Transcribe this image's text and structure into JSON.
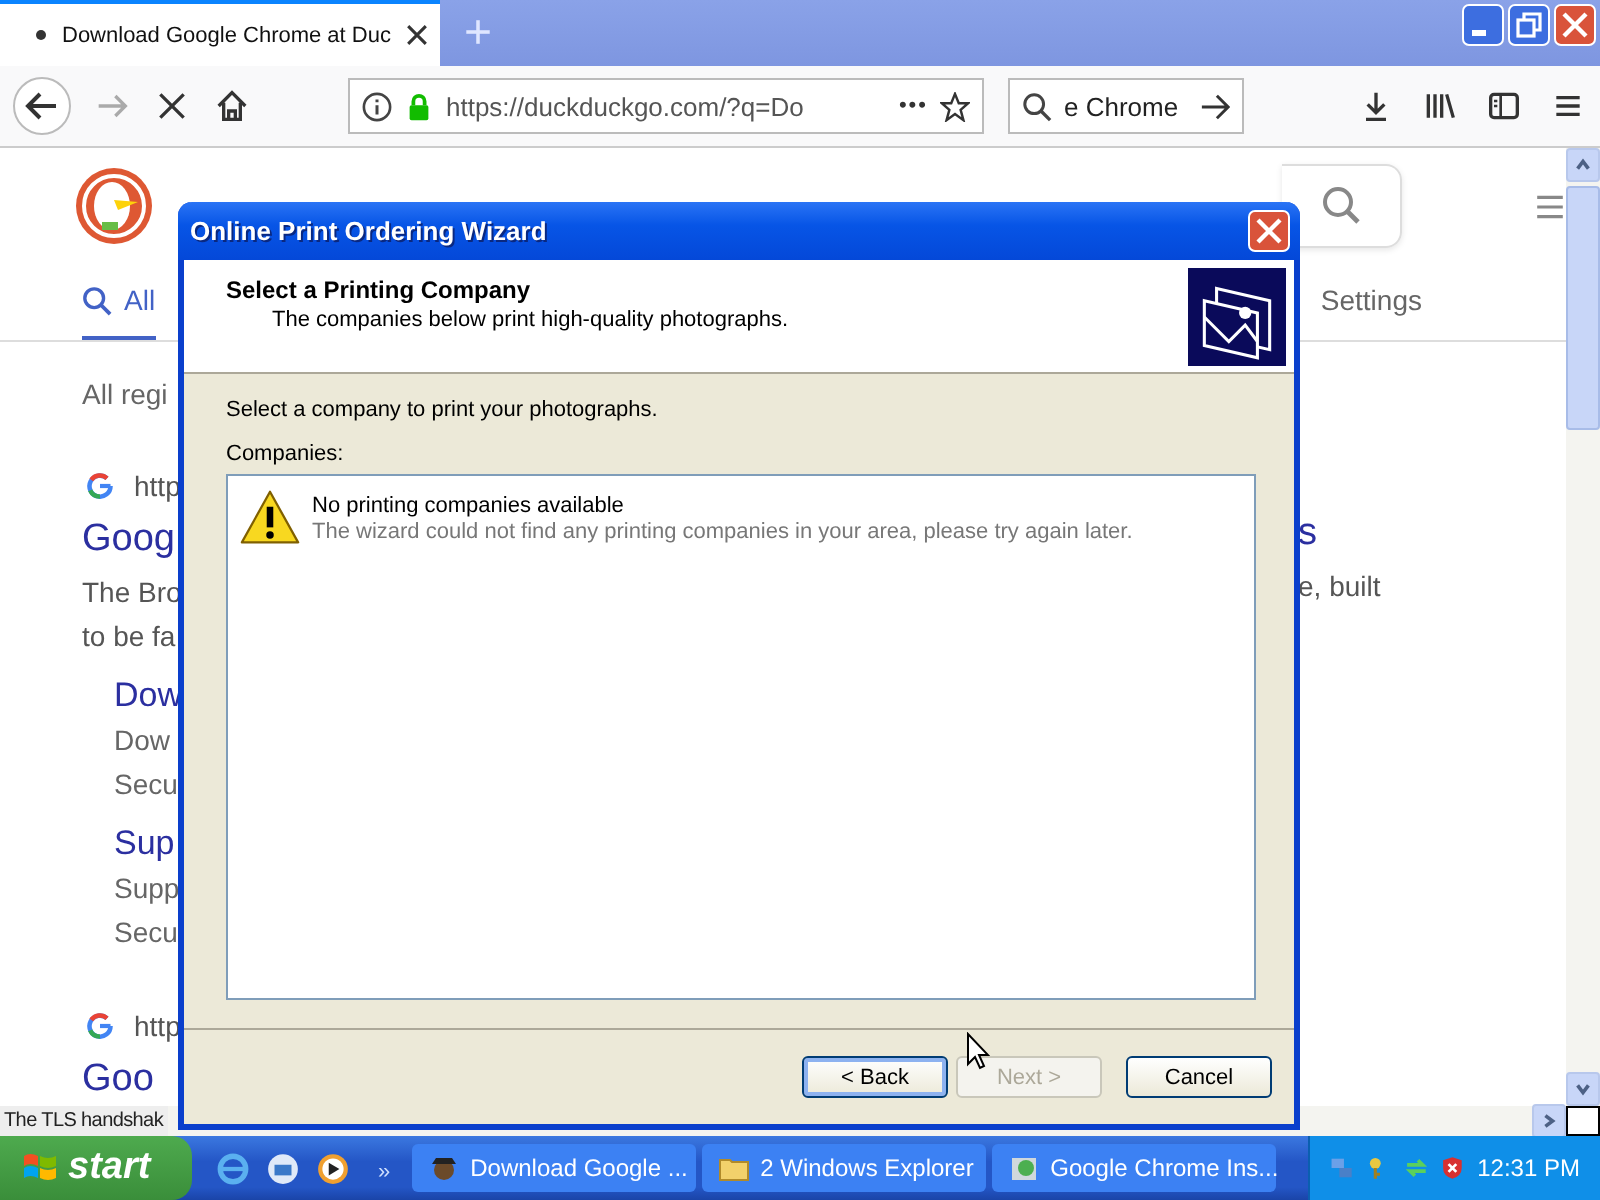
{
  "browser": {
    "tab": {
      "title": "Download Google Chrome at Duc",
      "loading": true
    },
    "new_tab": "+",
    "url": {
      "text": "https://duckduckgo.com/?q=Do",
      "secure": true
    },
    "more": "•••",
    "search_text": "e Chrome",
    "status": "The TLS handshak"
  },
  "page": {
    "tabs": [
      {
        "label": "All",
        "selected": true
      },
      {
        "label": "Settings",
        "selected": false
      }
    ],
    "left": [
      {
        "kind": "meta",
        "text": "All regi"
      },
      {
        "kind": "url",
        "text": "http"
      },
      {
        "kind": "title",
        "text": "Goog"
      },
      {
        "kind": "snippet",
        "text": "The Bro"
      },
      {
        "kind": "snippet",
        "text": "to be fa"
      },
      {
        "kind": "sublink",
        "text": "Dow"
      },
      {
        "kind": "subtext",
        "text": "Dow"
      },
      {
        "kind": "subtext",
        "text": "Secu"
      },
      {
        "kind": "sublink",
        "text": "Sup"
      },
      {
        "kind": "subtext",
        "text": "Supp"
      },
      {
        "kind": "subtext",
        "text": "Secu"
      },
      {
        "kind": "url",
        "text": "http"
      },
      {
        "kind": "title",
        "text": "Goo"
      }
    ],
    "right": [
      {
        "kind": "title",
        "text": "s"
      },
      {
        "kind": "snippet",
        "text": "e, built"
      }
    ]
  },
  "wizard": {
    "title": "Online Print Ordering Wizard",
    "heading": "Select a Printing Company",
    "subheading": "The companies below print high-quality photographs.",
    "instruction": "Select a company to print your photographs.",
    "list_label": "Companies:",
    "message_title": "No printing companies available",
    "message_body": "The wizard could not find any printing companies in your area, please try again later.",
    "buttons": [
      {
        "label": "< Back",
        "disabled": false,
        "default": true
      },
      {
        "label": "Next >",
        "disabled": true,
        "default": false
      },
      {
        "label": "Cancel",
        "disabled": false,
        "default": false
      }
    ]
  },
  "taskbar": {
    "start": "start",
    "more": "»",
    "tasks": [
      {
        "label": "Download Google ...",
        "kind": "browser"
      },
      {
        "label": "2 Windows Explorer",
        "kind": "folder"
      },
      {
        "label": "Google Chrome Ins...",
        "kind": "installer"
      }
    ],
    "clock": "12:31 PM"
  }
}
